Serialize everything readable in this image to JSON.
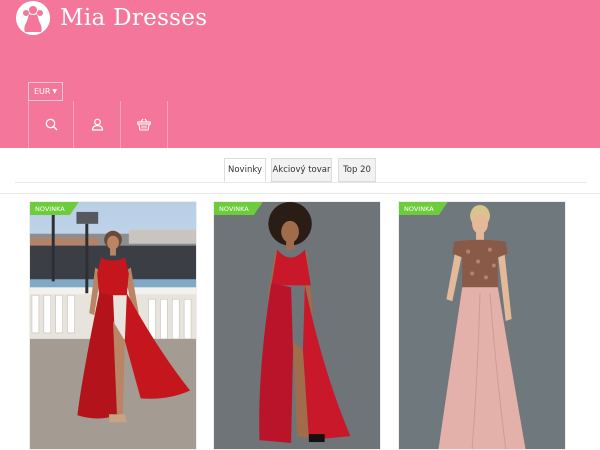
{
  "brand": {
    "name": "Mia Dresses",
    "logo_icon": "dress-logo-icon"
  },
  "header": {
    "currency": "EUR",
    "icons": [
      "search-icon",
      "user-icon",
      "basket-icon"
    ],
    "background": "#f5769b"
  },
  "tabs": [
    {
      "label": "Novinky",
      "active": true
    },
    {
      "label": "Akciový tovar",
      "active": false
    },
    {
      "label": "Top 20",
      "active": false
    }
  ],
  "products": [
    {
      "badge": "NOVINKA",
      "dress_color": "#c4161c"
    },
    {
      "badge": "NOVINKA",
      "dress_color": "#c8182a"
    },
    {
      "badge": "NOVINKA",
      "dress_color": "#e3b1aa"
    }
  ],
  "colors": {
    "badge": "#6ccc3c",
    "header": "#f5769b"
  }
}
